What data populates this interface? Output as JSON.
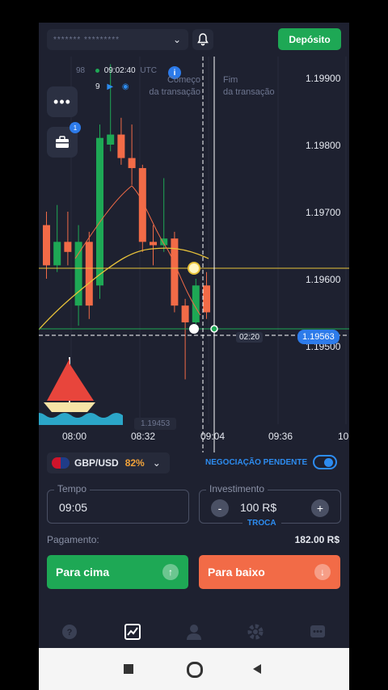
{
  "topbar": {
    "account_masked": "******* *********",
    "deposit_label": "Depósito"
  },
  "chart_info": {
    "time": "09:02:40",
    "tz": "UTC",
    "partial_left": "98",
    "partial_row2": "9",
    "start_label_1": "Começo",
    "start_label_2": "da transação",
    "end_label_1": "Fim",
    "end_label_2": "da transação",
    "countdown": "02:20",
    "current_price": "1.19563",
    "low_label": "1.19453",
    "badge_count": "1"
  },
  "chart_data": {
    "type": "candlestick",
    "y_ticks": [
      "1.19900",
      "1.19800",
      "1.19700",
      "1.19600",
      "1.19500"
    ],
    "x_ticks": [
      "08:00",
      "08:32",
      "09:04",
      "09:36",
      "10"
    ],
    "current_price": 1.19563,
    "ylim": [
      1.1942,
      1.1994
    ],
    "candles": [
      {
        "o": 1.1968,
        "c": 1.1962,
        "h": 1.197,
        "l": 1.196,
        "color": "red"
      },
      {
        "o": 1.1962,
        "c": 1.19655,
        "h": 1.1971,
        "l": 1.1961,
        "color": "green"
      },
      {
        "o": 1.19655,
        "c": 1.1964,
        "h": 1.197,
        "l": 1.1962,
        "color": "red"
      },
      {
        "o": 1.1956,
        "c": 1.19655,
        "h": 1.1968,
        "l": 1.1953,
        "color": "green"
      },
      {
        "o": 1.19655,
        "c": 1.1956,
        "h": 1.1967,
        "l": 1.1954,
        "color": "red"
      },
      {
        "o": 1.1959,
        "c": 1.1981,
        "h": 1.1983,
        "l": 1.1957,
        "color": "green"
      },
      {
        "o": 1.198,
        "c": 1.19815,
        "h": 1.1992,
        "l": 1.1979,
        "color": "green"
      },
      {
        "o": 1.19815,
        "c": 1.1978,
        "h": 1.1984,
        "l": 1.1977,
        "color": "red"
      },
      {
        "o": 1.1978,
        "c": 1.19765,
        "h": 1.1983,
        "l": 1.1974,
        "color": "red"
      },
      {
        "o": 1.19765,
        "c": 1.19655,
        "h": 1.1977,
        "l": 1.1964,
        "color": "red"
      },
      {
        "o": 1.19655,
        "c": 1.1965,
        "h": 1.1968,
        "l": 1.1962,
        "color": "red"
      },
      {
        "o": 1.1965,
        "c": 1.1966,
        "h": 1.1975,
        "l": 1.1964,
        "color": "green"
      },
      {
        "o": 1.1966,
        "c": 1.1956,
        "h": 1.1967,
        "l": 1.1955,
        "color": "red"
      },
      {
        "o": 1.1956,
        "c": 1.19535,
        "h": 1.1957,
        "l": 1.1945,
        "color": "red"
      },
      {
        "o": 1.19535,
        "c": 1.1959,
        "h": 1.196,
        "l": 1.1953,
        "color": "green"
      },
      {
        "o": 1.1959,
        "c": 1.1955,
        "h": 1.1961,
        "l": 1.1954,
        "color": "red"
      }
    ]
  },
  "asset": {
    "pair": "GBP/USD",
    "payout_pct": "82%"
  },
  "pending": {
    "label": "NEGOCIAÇÃO PENDENTE"
  },
  "time_field": {
    "label": "Tempo",
    "value": "09:05"
  },
  "invest_field": {
    "label": "Investimento",
    "value": "100 R$",
    "minus": "-",
    "plus": "+",
    "switch": "TROCA"
  },
  "payout": {
    "label": "Pagamento:",
    "value": "182.00 R$"
  },
  "buttons": {
    "up": "Para cima",
    "down": "Para baixo",
    "up_color": "#1ea855",
    "down_color": "#f26b47"
  },
  "nav": [
    "help-icon",
    "chart-icon",
    "profile-icon",
    "settings-icon",
    "chat-icon"
  ]
}
